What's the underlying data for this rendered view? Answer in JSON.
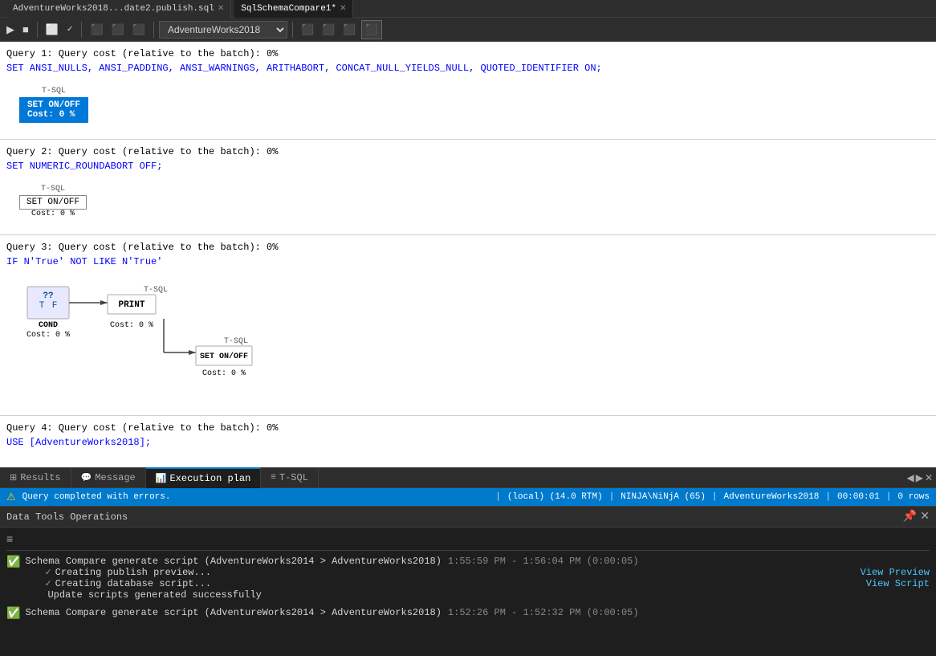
{
  "titlebar": {
    "tab1": {
      "label": "AdventureWorks2018...date2.publish.sql",
      "active": false,
      "modified": false
    },
    "tab2": {
      "label": "SqlSchemaCompare1*",
      "active": true,
      "modified": true
    }
  },
  "toolbar": {
    "run_btn": "▶",
    "db_value": "AdventureWorks2018"
  },
  "queries": [
    {
      "header": "Query 1: Query cost (relative to the batch): 0%",
      "sql": "SET ANSI_NULLS, ANSI_PADDING, ANSI_WARNINGS, ARITHABORT, CONCAT_NULL_YIELDS_NULL, QUOTED_IDENTIFIER ON;",
      "plan_type": "simple",
      "nodes": [
        {
          "top_label": "T-SQL",
          "main_label": "SET ON/OFF",
          "cost": "Cost: 0 %",
          "highlighted": true
        }
      ]
    },
    {
      "header": "Query 2: Query cost (relative to the batch): 0%",
      "sql": "SET NUMERIC_ROUNDABORT OFF;",
      "plan_type": "simple",
      "nodes": [
        {
          "top_label": "T-SQL",
          "main_label": "SET ON/OFF",
          "cost": "Cost: 0 %",
          "highlighted": false
        }
      ]
    },
    {
      "header": "Query 3: Query cost (relative to the batch): 0%",
      "sql": "IF N'True' NOT LIKE N'True'",
      "plan_type": "tree",
      "root": {
        "label": "COND",
        "cost": "Cost: 0 %",
        "children": [
          {
            "top_label": "T-SQL",
            "main_label": "PRINT",
            "cost": "Cost: 0 %",
            "children": [
              {
                "top_label": "T-SQL",
                "main_label": "SET ON/OFF",
                "cost": "Cost: 0 %"
              }
            ]
          }
        ]
      }
    },
    {
      "header": "Query 4: Query cost (relative to the batch): 0%",
      "sql": "USE [AdventureWorks2018];",
      "plan_type": "none"
    }
  ],
  "bottom_tabs": [
    {
      "label": "Results",
      "icon": "grid",
      "active": false
    },
    {
      "label": "Message",
      "icon": "message",
      "active": false
    },
    {
      "label": "Execution plan",
      "icon": "plan",
      "active": true
    },
    {
      "label": "T-SQL",
      "icon": "tsql",
      "active": false
    }
  ],
  "status_bar": {
    "warning_icon": "⚠",
    "message": "Query completed with errors.",
    "server": "(local) (14.0 RTM)",
    "user": "NINJA\\NiNjA (65)",
    "database": "AdventureWorks2018",
    "time": "00:00:01",
    "rows": "0 rows"
  },
  "data_tools_panel": {
    "title": "Data Tools Operations",
    "log_entries": [
      {
        "type": "success",
        "text": "Schema Compare generate script (AdventureWorks2014 > AdventureWorks2018)",
        "time": "1:55:59 PM - 1:56:04 PM (0:00:05)",
        "sub_items": [
          {
            "type": "check",
            "text": "Creating publish preview..."
          },
          {
            "type": "check",
            "text": "Creating database script..."
          },
          {
            "type": "info",
            "text": "Update scripts generated successfully"
          }
        ],
        "links": [
          {
            "label": "View Preview",
            "id": "view-preview"
          },
          {
            "label": "View Script",
            "id": "view-script"
          }
        ]
      },
      {
        "type": "success",
        "text": "Schema Compare generate script (AdventureWorks2014 > AdventureWorks2018)",
        "time": "1:52:26 PM - 1:52:32 PM (0:00:05)",
        "sub_items": [],
        "links": []
      }
    ]
  }
}
